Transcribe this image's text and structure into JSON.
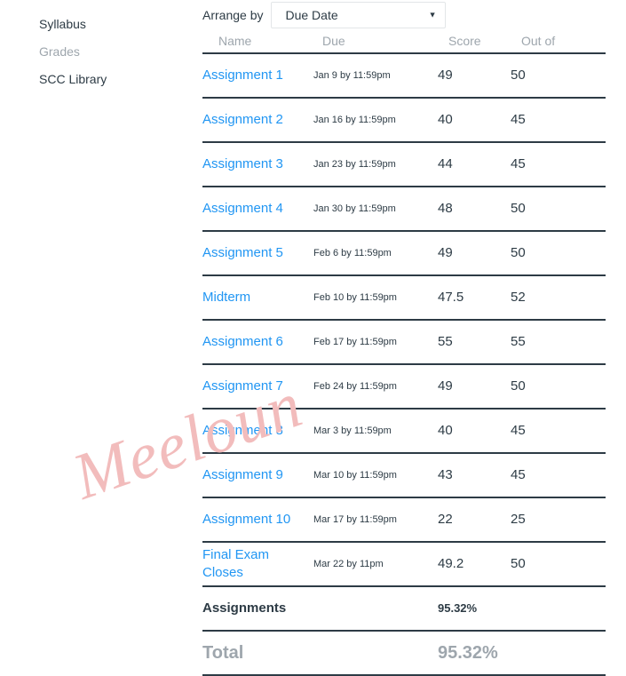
{
  "sidebar": {
    "items": [
      {
        "label": "Syllabus",
        "muted": false
      },
      {
        "label": "Grades",
        "muted": true
      },
      {
        "label": "SCC Library",
        "muted": false
      }
    ]
  },
  "arrange": {
    "label": "Arrange by",
    "selected": "Due Date",
    "caret": "▼",
    "options": [
      "Due Date"
    ]
  },
  "table": {
    "columns": {
      "name": "Name",
      "due": "Due",
      "score": "Score",
      "out_of": "Out of"
    },
    "rows": [
      {
        "name": "Assignment 1",
        "due": "Jan 9 by 11:59pm",
        "score": "49",
        "out_of": "50"
      },
      {
        "name": "Assignment 2",
        "due": "Jan 16 by 11:59pm",
        "score": "40",
        "out_of": "45"
      },
      {
        "name": "Assignment 3",
        "due": "Jan 23 by 11:59pm",
        "score": "44",
        "out_of": "45"
      },
      {
        "name": "Assignment 4",
        "due": "Jan 30 by 11:59pm",
        "score": "48",
        "out_of": "50"
      },
      {
        "name": "Assignment 5",
        "due": "Feb 6 by 11:59pm",
        "score": "49",
        "out_of": "50"
      },
      {
        "name": "Midterm",
        "due": "Feb 10 by 11:59pm",
        "score": "47.5",
        "out_of": "52"
      },
      {
        "name": "Assignment 6",
        "due": "Feb 17 by 11:59pm",
        "score": "55",
        "out_of": "55"
      },
      {
        "name": "Assignment 7",
        "due": "Feb 24 by 11:59pm",
        "score": "49",
        "out_of": "50"
      },
      {
        "name": "Assignment 8",
        "due": "Mar 3 by 11:59pm",
        "score": "40",
        "out_of": "45"
      },
      {
        "name": "Assignment 9",
        "due": "Mar 10 by 11:59pm",
        "score": "43",
        "out_of": "45"
      },
      {
        "name": "Assignment 10",
        "due": "Mar 17 by 11:59pm",
        "score": "22",
        "out_of": "25"
      },
      {
        "name": "Final Exam Closes",
        "due": "Mar 22 by 11pm",
        "score": "49.2",
        "out_of": "50"
      }
    ],
    "group_row": {
      "name": "Assignments",
      "score": "95.32%"
    },
    "total_row": {
      "name": "Total",
      "score": "95.32%"
    }
  },
  "watermark": {
    "text": "Meeloun"
  },
  "colors": {
    "link": "#2196f3",
    "text": "#2d3b45",
    "muted": "#9ea6ad",
    "watermark": "#f2bcbc"
  }
}
